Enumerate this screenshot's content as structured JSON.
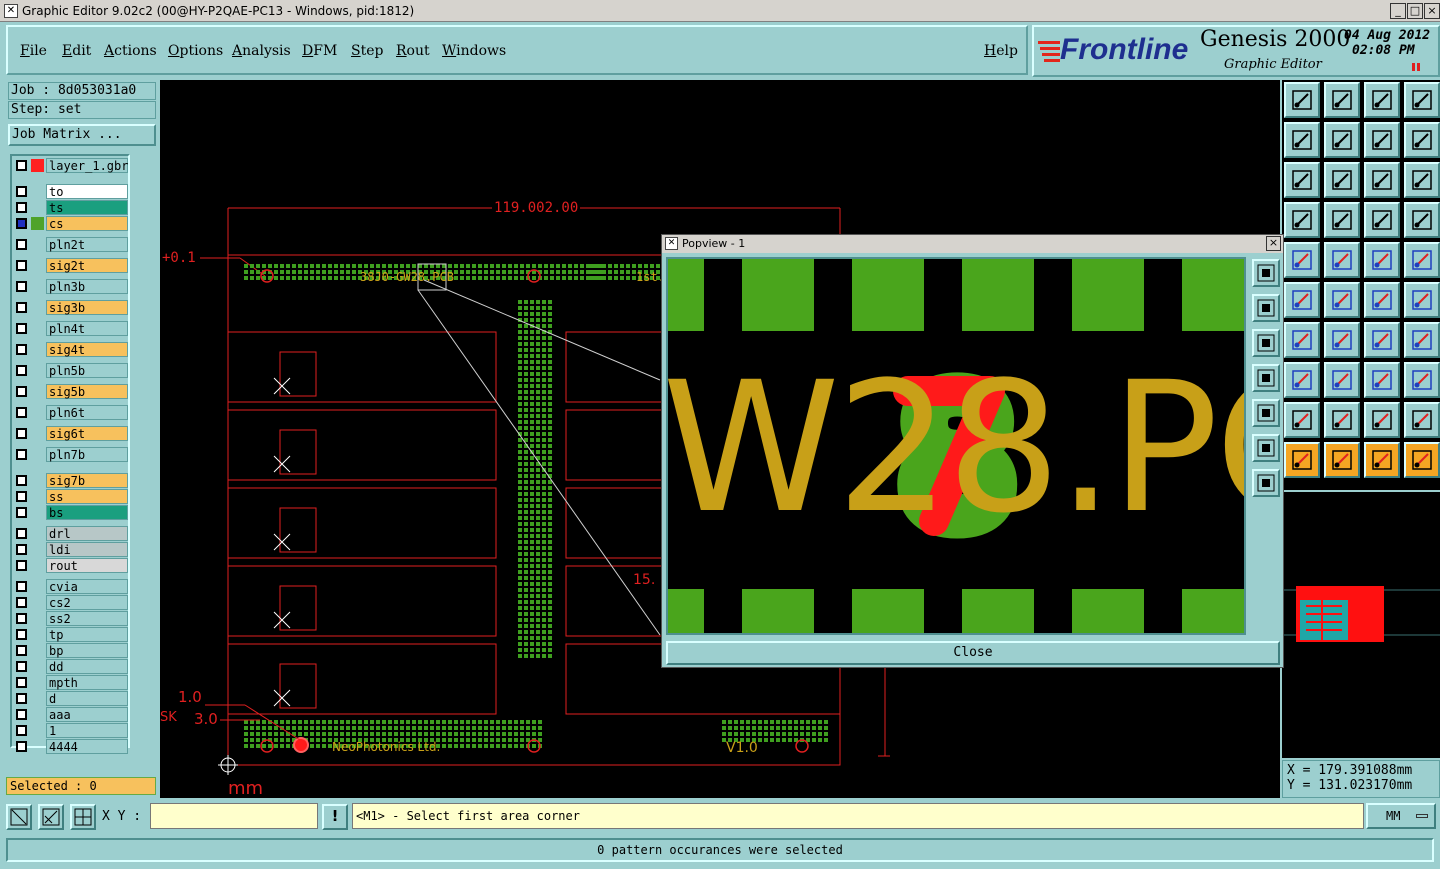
{
  "window": {
    "title": "Graphic Editor 9.02c2 (00@HY-P2QAE-PC13 - Windows, pid:1812)",
    "minimize": "_",
    "maximize": "□",
    "close": "×"
  },
  "menu": {
    "items": [
      "File",
      "Edit",
      "Actions",
      "Options",
      "Analysis",
      "DFM",
      "Step",
      "Rout",
      "Windows"
    ],
    "help": "Help"
  },
  "brand": {
    "logo_text": "Frontline",
    "product": "Genesis 2000",
    "subtitle": "Graphic Editor",
    "date": "04  Aug  2012",
    "time": "02:08  PM",
    "colors": {
      "logo_blue": "#1e2f8f",
      "logo_red": "#e2261c"
    }
  },
  "job": {
    "job_label": "Job  :  8d053031a0",
    "step_label": "Step:  set",
    "matrix_button": "Job Matrix ..."
  },
  "layers": [
    {
      "name": "layer_1.gbr",
      "bg": "#9ccfcf",
      "swatch": "#ff2020",
      "group": 0
    },
    {
      "name": "to",
      "bg": "#ffffff",
      "swatch": "",
      "group": 1
    },
    {
      "name": "ts",
      "bg": "#1a9f7f",
      "swatch": "",
      "group": 1
    },
    {
      "name": "cs",
      "bg": "#f7c15d",
      "swatch": "#4fa32a",
      "group": 1,
      "active": true
    },
    {
      "name": "pln2t",
      "bg": "#9ccfcf",
      "swatch": "",
      "group": 2
    },
    {
      "name": "sig2t",
      "bg": "#f7c15d",
      "swatch": "",
      "group": 2
    },
    {
      "name": "pln3b",
      "bg": "#9ccfcf",
      "swatch": "",
      "group": 2
    },
    {
      "name": "sig3b",
      "bg": "#f7c15d",
      "swatch": "",
      "group": 2
    },
    {
      "name": "pln4t",
      "bg": "#9ccfcf",
      "swatch": "",
      "group": 2
    },
    {
      "name": "sig4t",
      "bg": "#f7c15d",
      "swatch": "",
      "group": 2
    },
    {
      "name": "pln5b",
      "bg": "#9ccfcf",
      "swatch": "",
      "group": 2
    },
    {
      "name": "sig5b",
      "bg": "#f7c15d",
      "swatch": "",
      "group": 2
    },
    {
      "name": "pln6t",
      "bg": "#9ccfcf",
      "swatch": "",
      "group": 2
    },
    {
      "name": "sig6t",
      "bg": "#f7c15d",
      "swatch": "",
      "group": 2
    },
    {
      "name": "pln7b",
      "bg": "#9ccfcf",
      "swatch": "",
      "group": 2
    },
    {
      "name": "sig7b",
      "bg": "#f7c15d",
      "swatch": "",
      "group": 3
    },
    {
      "name": "ss",
      "bg": "#f7c15d",
      "swatch": "",
      "group": 3
    },
    {
      "name": "bs",
      "bg": "#1a9f7f",
      "swatch": "",
      "group": 3
    },
    {
      "name": "drl",
      "bg": "#b7c7c7",
      "swatch": "",
      "group": 4
    },
    {
      "name": "ldi",
      "bg": "#b7c7c7",
      "swatch": "",
      "group": 4
    },
    {
      "name": "rout",
      "bg": "#d8d8d8",
      "swatch": "",
      "group": 4
    },
    {
      "name": "cvia",
      "bg": "#9ccfcf",
      "swatch": "",
      "group": 5
    },
    {
      "name": "cs2",
      "bg": "#9ccfcf",
      "swatch": "",
      "group": 5
    },
    {
      "name": "ss2",
      "bg": "#9ccfcf",
      "swatch": "",
      "group": 5
    },
    {
      "name": "tp",
      "bg": "#9ccfcf",
      "swatch": "",
      "group": 5
    },
    {
      "name": "bp",
      "bg": "#9ccfcf",
      "swatch": "",
      "group": 5
    },
    {
      "name": "dd",
      "bg": "#9ccfcf",
      "swatch": "",
      "group": 5
    },
    {
      "name": "mpth",
      "bg": "#9ccfcf",
      "swatch": "",
      "group": 5
    },
    {
      "name": "d",
      "bg": "#9ccfcf",
      "swatch": "",
      "group": 5
    },
    {
      "name": "aaa",
      "bg": "#9ccfcf",
      "swatch": "",
      "group": 5
    },
    {
      "name": "1",
      "bg": "#9ccfcf",
      "swatch": "",
      "group": 5
    },
    {
      "name": "4444",
      "bg": "#9ccfcf",
      "swatch": "",
      "group": 5
    }
  ],
  "selected": "Selected : 0",
  "canvas": {
    "dimension_top": "119.002.00",
    "offset_label": "+0.1",
    "pcb_text_top": "38J0-GW28.PCB",
    "pcb_text_top2": "1st.",
    "pcb_text_bottom": "NeoPhotonics Ltd.",
    "version_text": "V1.0",
    "label_1_0": "1.0",
    "label_sk": "SK",
    "label_3_0": "3.0",
    "label_15": "15.",
    "units_label": "mm"
  },
  "popview": {
    "title": "Popview - 1",
    "zoom_text": "W28.PC",
    "close_button": "Close"
  },
  "coords": {
    "x": "X  =  179.391088mm",
    "y": "Y  =  131.023170mm"
  },
  "bottom": {
    "xy_label": "X Y :",
    "xy_value": "",
    "bang": "!",
    "prompt": "<M1> - Select first area corner",
    "units": "MM",
    "status": "0 pattern occurances were selected"
  },
  "colors": {
    "panel": "#9ccfcf",
    "outline_red": "#e02020",
    "copper_green": "#3f9f1f",
    "pad_green": "#4aa51c",
    "text_gold": "#c8a018",
    "highlight_red": "#ff1a1a"
  }
}
